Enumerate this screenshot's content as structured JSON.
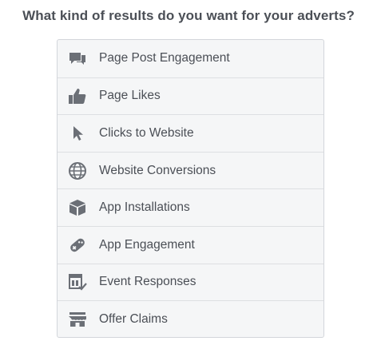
{
  "prompt": {
    "title": "What kind of results do you want for your adverts?"
  },
  "objectives": [
    {
      "label": "Page Post Engagement",
      "icon": "speech-bubbles-icon"
    },
    {
      "label": "Page Likes",
      "icon": "thumbs-up-icon"
    },
    {
      "label": "Clicks to Website",
      "icon": "cursor-icon"
    },
    {
      "label": "Website Conversions",
      "icon": "globe-icon"
    },
    {
      "label": "App Installations",
      "icon": "box-icon"
    },
    {
      "label": "App Engagement",
      "icon": "gamepad-icon"
    },
    {
      "label": "Event Responses",
      "icon": "calendar-icon"
    },
    {
      "label": "Offer Claims",
      "icon": "storefront-icon"
    }
  ],
  "colors": {
    "text": "#4b4f56",
    "icon": "#6b6f76",
    "list_bg": "#f5f6f7",
    "border": "#dddfe2"
  }
}
